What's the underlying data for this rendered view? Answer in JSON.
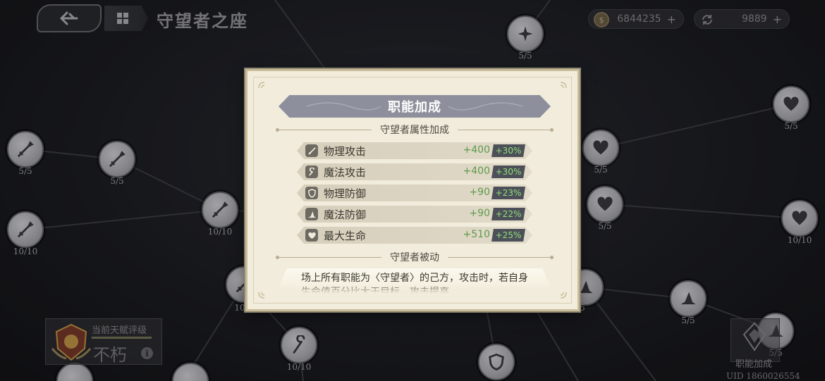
{
  "header": {
    "title": "守望者之座",
    "back_icon": "back-arrow-icon",
    "menu_icon": "grid-menu-icon"
  },
  "currencies": [
    {
      "icon": "gold-coin-icon",
      "amount": "6844235",
      "plus": "+"
    },
    {
      "icon": "refresh-currency-icon",
      "amount": "9889",
      "plus": "+"
    }
  ],
  "talent_nodes": [
    {
      "count": "5/5",
      "icon": "sword-icon"
    },
    {
      "count": "5/5",
      "icon": "sword-icon"
    },
    {
      "count": "10/10",
      "icon": "sword-icon"
    },
    {
      "count": "10/10",
      "icon": "sword-icon"
    },
    {
      "count": "10",
      "icon": "sword-icon"
    },
    {
      "count": "10/10",
      "icon": "staff-icon"
    },
    {
      "count": "5/5",
      "icon": "sparkle-icon"
    },
    {
      "count": "5/5",
      "icon": "heart-icon"
    },
    {
      "count": "5/5",
      "icon": "heart-icon"
    },
    {
      "count": "5/5",
      "icon": "heart-icon"
    },
    {
      "count": "10/10",
      "icon": "heart-icon"
    },
    {
      "count": "5",
      "icon": "hat-icon"
    },
    {
      "count": "5/5",
      "icon": "hat-icon"
    },
    {
      "count": "5/5",
      "icon": "hat-icon"
    },
    {
      "count": "",
      "icon": "shield-icon"
    }
  ],
  "rating": {
    "label": "当前天赋评级",
    "value": "不朽",
    "info": "i"
  },
  "job_bonus_button": {
    "label": "职能加成"
  },
  "uid": "UID 1860026554",
  "modal": {
    "title": "职能加成",
    "attr_section": "守望者属性加成",
    "stats": [
      {
        "icon": "sword-stat-icon",
        "name": "物理攻击",
        "flat": "+400",
        "pct": "+30%"
      },
      {
        "icon": "wand-stat-icon",
        "name": "魔法攻击",
        "flat": "+400",
        "pct": "+30%"
      },
      {
        "icon": "shield-stat-icon",
        "name": "物理防御",
        "flat": "+90",
        "pct": "+23%"
      },
      {
        "icon": "hat-stat-icon",
        "name": "魔法防御",
        "flat": "+90",
        "pct": "+22%"
      },
      {
        "icon": "heart-stat-icon",
        "name": "最大生命",
        "flat": "+510",
        "pct": "+25%"
      }
    ],
    "passive_section": "守望者被动",
    "passive_text": "场上所有职能为〈守望者〉的己方，攻击时，若自身生命值百分比大于目标，攻击提高"
  }
}
